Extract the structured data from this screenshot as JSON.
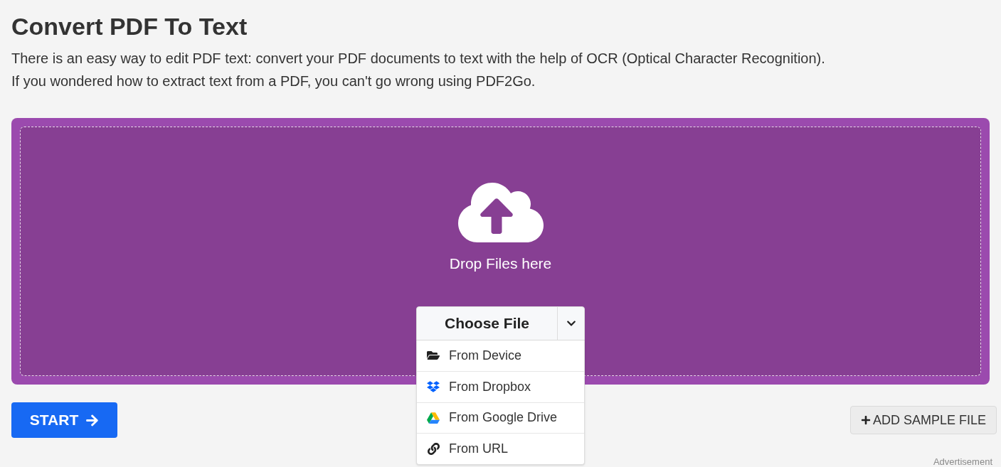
{
  "title": "Convert PDF To Text",
  "description": "There is an easy way to edit PDF text: convert your PDF documents to text with the help of OCR (Optical Character Recognition). If you wondered how to extract text from a PDF, you can't go wrong using PDF2Go.",
  "dropzone": {
    "label": "Drop Files here"
  },
  "choose_file": {
    "label": "Choose File",
    "expanded": true,
    "options": [
      {
        "kind": "device",
        "label": "From Device"
      },
      {
        "kind": "dropbox",
        "label": "From Dropbox"
      },
      {
        "kind": "drive",
        "label": "From Google Drive"
      },
      {
        "kind": "url",
        "label": "From URL"
      }
    ]
  },
  "start_button": "START",
  "sample_button": "ADD SAMPLE FILE",
  "ad_label": "Advertisement"
}
